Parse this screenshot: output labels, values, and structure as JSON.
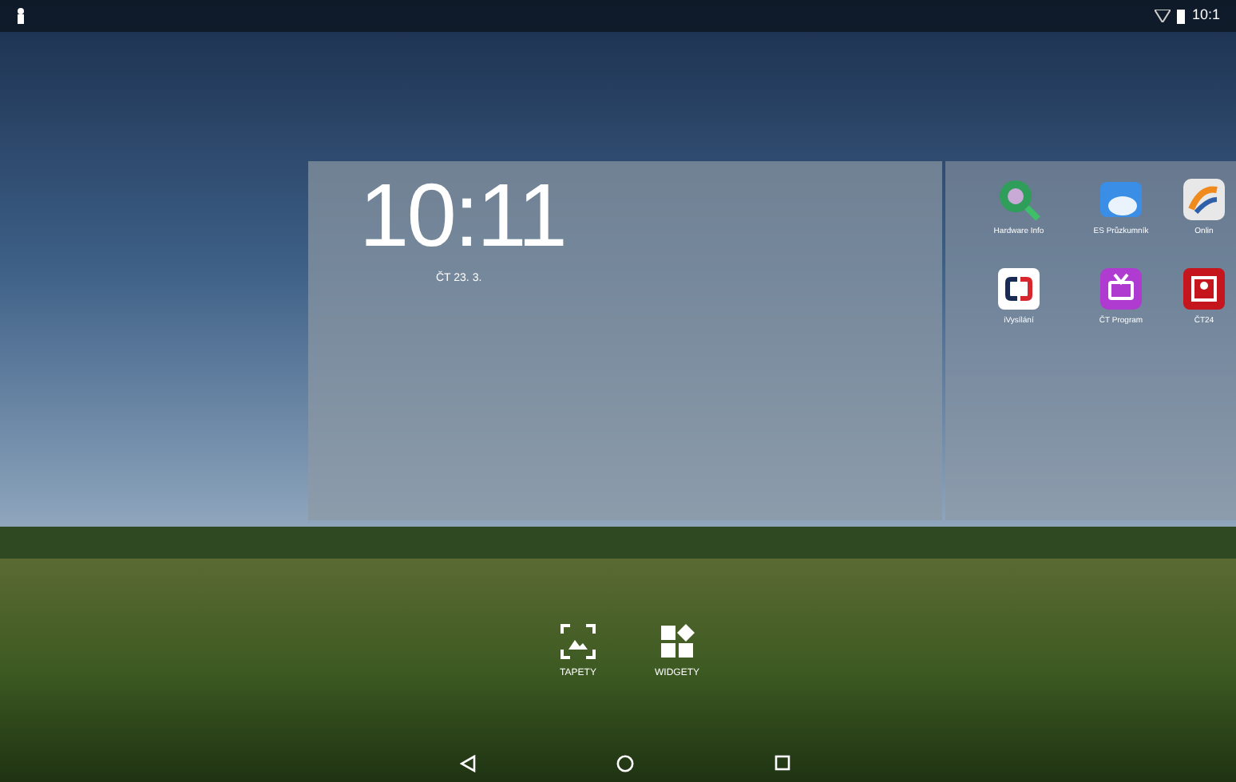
{
  "status_bar": {
    "time": "10:1"
  },
  "clock_widget": {
    "time": "10:11",
    "date": "ČT 23. 3."
  },
  "apps": [
    {
      "label": "Hardware Info",
      "kind": "hardware"
    },
    {
      "label": "ES Průzkumník",
      "kind": "files"
    },
    {
      "label": "Onlin",
      "kind": "swirl"
    },
    {
      "label": "iVysílání",
      "kind": "ct"
    },
    {
      "label": "ČT Program",
      "kind": "tv"
    },
    {
      "label": "ČT24",
      "kind": "news"
    }
  ],
  "options": [
    {
      "label": "TAPETY",
      "kind": "wallpaper"
    },
    {
      "label": "WIDGETY",
      "kind": "widgets"
    }
  ]
}
